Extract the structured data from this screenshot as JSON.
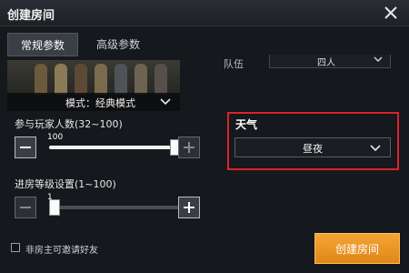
{
  "window": {
    "title": "创建房间"
  },
  "tabs": [
    {
      "label": "常规参数",
      "active": true
    },
    {
      "label": "高级参数",
      "active": false
    }
  ],
  "mode": {
    "label": "模式：经典模式"
  },
  "team": {
    "label": "队伍",
    "value": "四人"
  },
  "players": {
    "label": "参与玩家人数(32~100)",
    "value": 100,
    "min": 32,
    "max": 100
  },
  "level": {
    "label": "进房等级设置(1~100)",
    "value": 1,
    "min": 1,
    "max": 100
  },
  "weather": {
    "label": "天气",
    "value": "昼夜",
    "highlight_color": "#d9232a"
  },
  "invite": {
    "label": "非房主可邀请好友",
    "checked": false
  },
  "actions": {
    "create_label": "创建房间"
  },
  "colors": {
    "accent": "#f0962a",
    "panel": "#15181c"
  },
  "icons": [
    "close-icon",
    "chevron-down-icon",
    "minus-icon",
    "plus-icon",
    "checkbox-icon"
  ]
}
